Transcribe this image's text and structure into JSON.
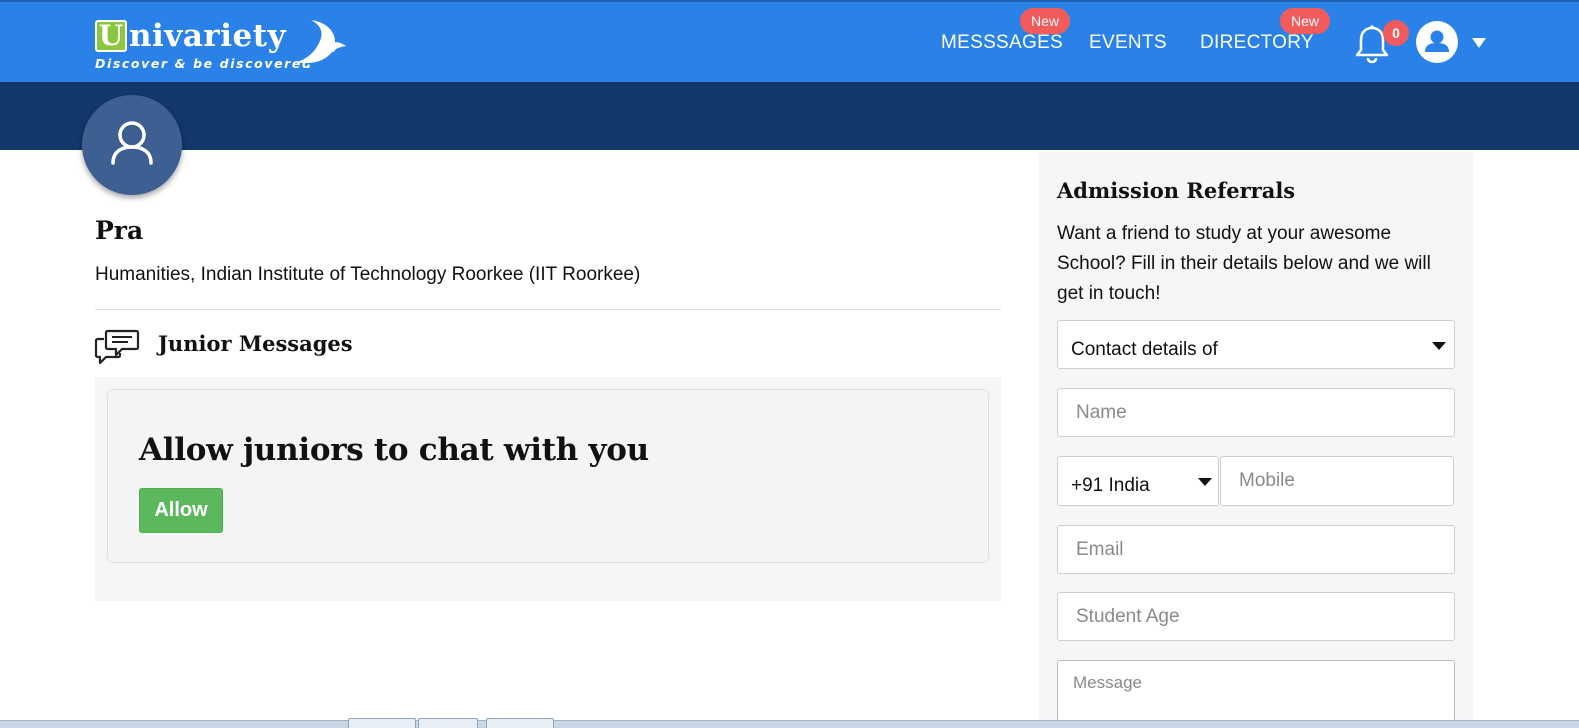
{
  "brand": {
    "logo_letter": "U",
    "logo_rest": "nivariety",
    "tagline": "Discover & be discovered"
  },
  "nav": {
    "items": [
      {
        "label": "MESSSAGES",
        "badge": "New"
      },
      {
        "label": "EVENTS",
        "badge": ""
      },
      {
        "label": "DIRECTORY",
        "badge": "New"
      }
    ],
    "notifications_count": "0",
    "icons": {
      "bell": "bell-icon",
      "user": "user-avatar-icon",
      "caret": "caret-down-icon"
    }
  },
  "profile": {
    "name": "Pra",
    "subtitle": "Humanities, Indian Institute of Technology Roorkee (IIT Roorkee)"
  },
  "junior_messages": {
    "title": "Junior Messages",
    "heading": "Allow juniors to chat with you",
    "button_label": "Allow"
  },
  "referrals": {
    "title": "Admission Referrals",
    "description": "Want a friend to study at your awesome School? Fill in their details below and we will get in touch!",
    "contact_select": "Contact details of",
    "name_placeholder": "Name",
    "country_select": "+91 India",
    "mobile_placeholder": "Mobile",
    "email_placeholder": "Email",
    "age_placeholder": "Student Age",
    "message_placeholder": "Message"
  },
  "colors": {
    "header": "#2a82e8",
    "cover": "#12376a",
    "badge": "#f25b5b",
    "allow_button": "#5cb85c",
    "logo_green": "#8cc63f"
  }
}
